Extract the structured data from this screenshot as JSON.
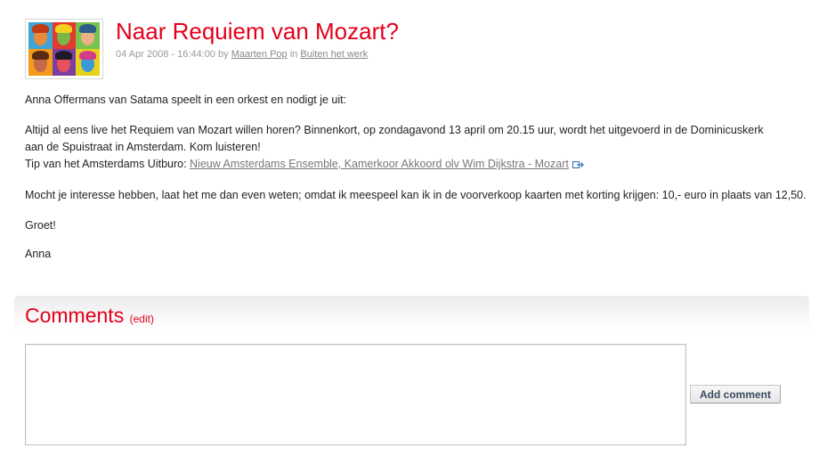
{
  "post": {
    "title": "Naar Requiem van Mozart?",
    "date": "04 Apr 2008 - 16:44:00",
    "by_word": "by",
    "author": "Maarten Pop",
    "in_word": "in",
    "category": "Buiten het werk"
  },
  "avatar": {
    "tiles": [
      {
        "bg": "#3fa4d6",
        "hair": "#c23b14",
        "face": "#e88a3a"
      },
      {
        "bg": "#e23a2e",
        "hair": "#f2d21e",
        "face": "#7ab64a"
      },
      {
        "bg": "#7ac24e",
        "hair": "#2d5f8a",
        "face": "#e9b184"
      },
      {
        "bg": "#f39a1c",
        "hair": "#5a2b12",
        "face": "#c46a4a"
      },
      {
        "bg": "#7a3fa0",
        "hair": "#1f1a2a",
        "face": "#e8505a"
      },
      {
        "bg": "#e8d21a",
        "hair": "#d23d8a",
        "face": "#3a9ad6"
      }
    ]
  },
  "body": {
    "intro": "Anna Offermans van Satama speelt in een orkest en nodigt je uit:",
    "para2_line1": "Altijd al eens live het Requiem van Mozart willen horen? Binnenkort, op zondagavond 13 april om 20.15 uur, wordt het uitgevoerd in de Dominicuskerk",
    "para2_line2": "aan de Spuistraat in Amsterdam. Kom luisteren!",
    "tip_prefix": "Tip van het Amsterdams Uitburo: ",
    "tip_link": "Nieuw Amsterdams Ensemble, Kamerkoor Akkoord olv Wim Dijkstra - Mozart",
    "para3": "Mocht je interesse hebben, laat het me dan even weten; omdat ik meespeel kan ik in de voorverkoop kaarten met korting krijgen: 10,- euro in plaats van 12,50.",
    "greeting": "Groet!",
    "signature": "Anna"
  },
  "comments": {
    "title": "Comments",
    "edit_label": "(edit)",
    "textarea_value": "",
    "add_button": "Add comment"
  },
  "colors": {
    "accent": "#e3001b",
    "link": "#777777",
    "external_icon": "#2b6fb3"
  }
}
